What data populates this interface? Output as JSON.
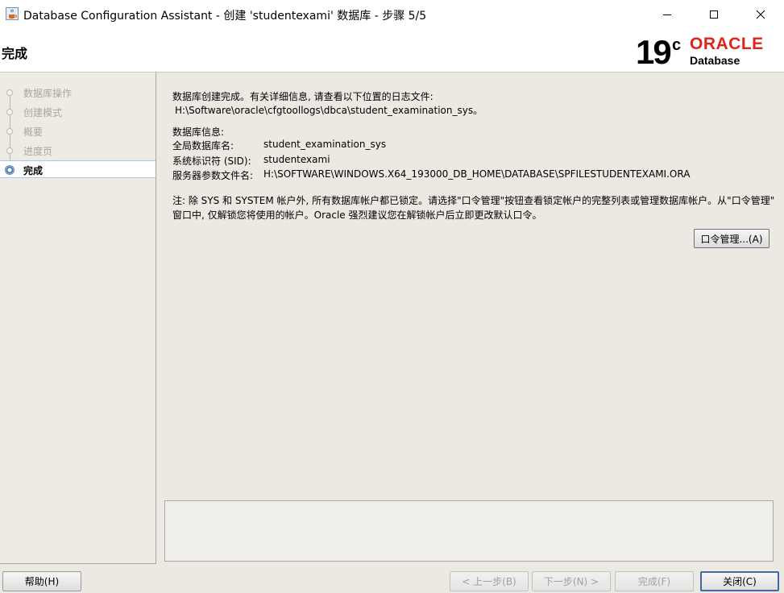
{
  "window": {
    "title": "Database Configuration Assistant - 创建 'studentexami' 数据库 - 步骤 5/5"
  },
  "header": {
    "page_title": "完成",
    "logo_version": "19",
    "logo_version_suffix": "c",
    "logo_brand": "ORACLE",
    "logo_product": "Database"
  },
  "nav": {
    "items": [
      {
        "label": "数据库操作"
      },
      {
        "label": "创建模式"
      },
      {
        "label": "概要"
      },
      {
        "label": "进度页"
      },
      {
        "label": "完成"
      }
    ]
  },
  "main": {
    "intro_line1": "数据库创建完成。有关详细信息, 请查看以下位置的日志文件:",
    "log_path": "H:\\Software\\oracle\\cfgtoollogs\\dbca\\student_examination_sys。",
    "db_info_heading": "数据库信息:",
    "info_rows": [
      {
        "label": "全局数据库名:",
        "value": "student_examination_sys"
      },
      {
        "label": "系统标识符 (SID):",
        "value": "studentexami"
      },
      {
        "label": "服务器参数文件名:",
        "value": "H:\\SOFTWARE\\WINDOWS.X64_193000_DB_HOME\\DATABASE\\SPFILESTUDENTEXAMI.ORA"
      }
    ],
    "note_line1": "注: 除 SYS 和 SYSTEM 帐户外, 所有数据库帐户都已锁定。请选择\"口令管理\"按钮查看锁定帐户的完整列表或管理数据库帐户。从\"口令管理\"",
    "note_line2": "窗口中, 仅解锁您将使用的帐户。Oracle 强烈建议您在解锁帐户后立即更改默认口令。",
    "password_button": "口令管理...(A)"
  },
  "footer": {
    "help": "帮助(H)",
    "back": "< 上一步(B)",
    "next": "下一步(N) >",
    "finish": "完成(F)",
    "close": "关闭(C)"
  },
  "colors": {
    "oracle_red": "#e2231a",
    "window_bg": "#ece9e2",
    "active_border": "#3f6aa3"
  },
  "icons": {
    "app": "java-cup-icon",
    "minimize": "minimize-icon",
    "maximize": "maximize-icon",
    "close": "close-icon"
  }
}
